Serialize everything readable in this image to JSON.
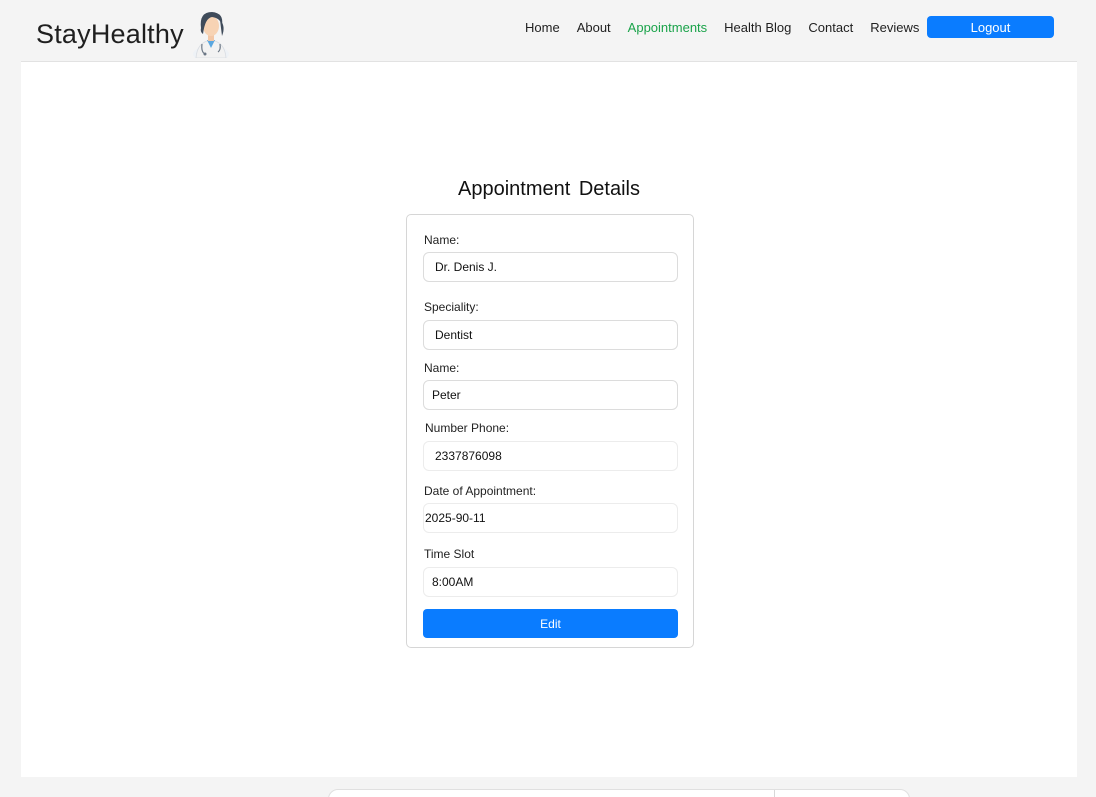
{
  "app": {
    "brand": "StayHealthy",
    "logo_icon": "doctor-avatar-icon"
  },
  "nav": {
    "items": [
      {
        "label": "Home",
        "active": false
      },
      {
        "label": "About",
        "active": false
      },
      {
        "label": "Appointments",
        "active": true
      },
      {
        "label": "Health Blog",
        "active": false
      },
      {
        "label": "Contact",
        "active": false
      },
      {
        "label": "Reviews",
        "active": false
      }
    ],
    "logout_label": "Logout"
  },
  "colors": {
    "accent": "#0a7cff",
    "active_nav": "#1aa34a",
    "background": "#f4f4f4"
  },
  "page": {
    "title": "Appointment  Details"
  },
  "form": {
    "doctor_name_label": "Name:",
    "doctor_name_value": "Dr. Denis J.",
    "speciality_label": "Speciality:",
    "speciality_value": "Dentist",
    "patient_name_label": "Name:",
    "patient_name_value": "Peter",
    "phone_label": "Number Phone:",
    "phone_value": "2337876098",
    "date_label": "Date of Appointment:",
    "date_value": "2025-90-11",
    "time_label": "Time Slot",
    "time_value": "8:00AM",
    "edit_label": "Edit"
  }
}
